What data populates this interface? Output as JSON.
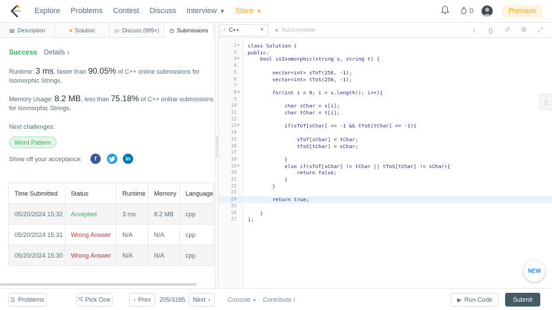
{
  "nav": {
    "items": [
      {
        "label": "Explore"
      },
      {
        "label": "Problems"
      },
      {
        "label": "Contest"
      },
      {
        "label": "Discuss"
      },
      {
        "label": "Interview"
      },
      {
        "label": "Store"
      }
    ],
    "fire_count": "0",
    "premium_label": "Premium"
  },
  "left_tabs": [
    {
      "label": "Description",
      "icon": "document-icon"
    },
    {
      "label": "Solution",
      "icon": "lock-icon"
    },
    {
      "label": "Discuss (999+)",
      "icon": "chat-icon"
    },
    {
      "label": "Submissions",
      "icon": "clock-icon"
    }
  ],
  "result": {
    "status": "Success",
    "details_label": "Details",
    "runtime_prefix": "Runtime:",
    "runtime_value": "3 ms",
    "runtime_mid": ", faster than",
    "runtime_pct": "90.05%",
    "runtime_suffix": "of C++ online submissions for Isomorphic Strings.",
    "memory_prefix": "Memory Usage:",
    "memory_value": "8.2 MB",
    "memory_mid": ", less than",
    "memory_pct": "75.18%",
    "memory_suffix": "of C++ online submissions for Isomorphic Strings.",
    "next_label": "Next challenges:",
    "next_tag": "Word Pattern",
    "share_label": "Show off your acceptance:"
  },
  "table": {
    "headers": [
      "Time Submitted",
      "Status",
      "Runtime",
      "Memory",
      "Language"
    ],
    "rows": [
      {
        "time": "05/20/2024 15:32",
        "status": "Accepted",
        "runtime": "3 ms",
        "memory": "8.2 MB",
        "lang": "cpp"
      },
      {
        "time": "05/20/2024 15:31",
        "status": "Wrong Answer",
        "runtime": "N/A",
        "memory": "N/A",
        "lang": "cpp"
      },
      {
        "time": "05/20/2024 15:30",
        "status": "Wrong Answer",
        "runtime": "N/A",
        "memory": "N/A",
        "lang": "cpp"
      }
    ]
  },
  "editor": {
    "language": "C++",
    "autocomplete_label": "Autocomplete",
    "lines": [
      "class Solution {",
      "public:",
      "    bool isIsomorphic(string s, string t) {",
      "",
      "        vector<int> sToT(256, -1);",
      "        vector<int> tToS(256, -1);",
      "",
      "        for(int i = 0; i < s.length(); i++){",
      "",
      "            char sChar = s[i];",
      "            char tChar = t[i];",
      "",
      "            if(sToT[sChar] == -1 && tToS[tChar] == -1){",
      "",
      "                sToT[sChar] = tChar;",
      "                tToS[tChar] = sChar;",
      "",
      "            }",
      "            else if(sToT[sChar] != tChar || tToS[tChar] != sChar){",
      "                return false;",
      "            }",
      "        }",
      "",
      "        return true;",
      "",
      "    }",
      "};"
    ],
    "fold_lines": [
      1,
      3,
      8,
      13,
      19
    ],
    "highlight_line": 24,
    "new_label": "NEW"
  },
  "footer": {
    "problems_label": "Problems",
    "pick_one_label": "Pick One",
    "prev_label": "Prev",
    "page": "205/3185",
    "next_label": "Next",
    "console_label": "Console",
    "contribute_label": "Contribute",
    "run_code_label": "Run Code",
    "submit_label": "Submit"
  },
  "colors": {
    "accent": "#ffa116",
    "success": "#2db55d",
    "error": "#d32f2f",
    "facebook": "#3b5998",
    "twitter": "#1da1f2",
    "linkedin": "#0077b5"
  }
}
